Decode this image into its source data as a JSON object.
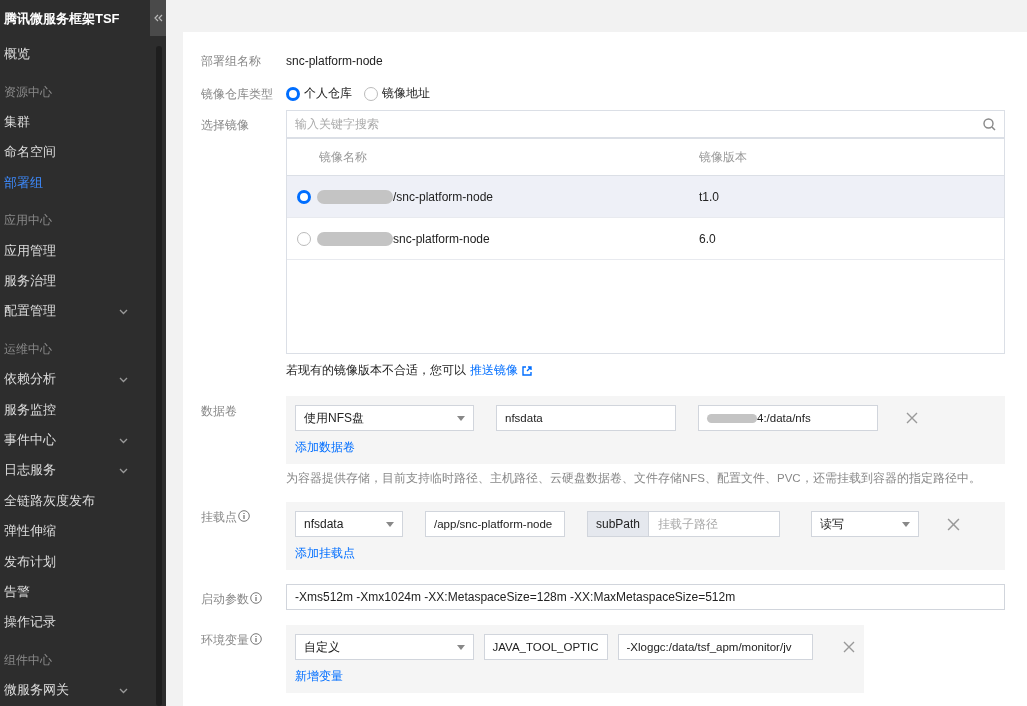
{
  "sidebar": {
    "title": "腾讯微服务框架TSF",
    "items": [
      {
        "kind": "item",
        "label": "概览",
        "selected": false,
        "expandable": false
      },
      {
        "kind": "group",
        "label": "资源中心"
      },
      {
        "kind": "item",
        "label": "集群",
        "selected": false,
        "expandable": false
      },
      {
        "kind": "item",
        "label": "命名空间",
        "selected": false,
        "expandable": false
      },
      {
        "kind": "item",
        "label": "部署组",
        "selected": true,
        "expandable": false
      },
      {
        "kind": "group",
        "label": "应用中心"
      },
      {
        "kind": "item",
        "label": "应用管理",
        "selected": false,
        "expandable": false
      },
      {
        "kind": "item",
        "label": "服务治理",
        "selected": false,
        "expandable": false
      },
      {
        "kind": "item",
        "label": "配置管理",
        "selected": false,
        "expandable": true
      },
      {
        "kind": "group",
        "label": "运维中心"
      },
      {
        "kind": "item",
        "label": "依赖分析",
        "selected": false,
        "expandable": true
      },
      {
        "kind": "item",
        "label": "服务监控",
        "selected": false,
        "expandable": false
      },
      {
        "kind": "item",
        "label": "事件中心",
        "selected": false,
        "expandable": true
      },
      {
        "kind": "item",
        "label": "日志服务",
        "selected": false,
        "expandable": true
      },
      {
        "kind": "item",
        "label": "全链路灰度发布",
        "selected": false,
        "expandable": false
      },
      {
        "kind": "item",
        "label": "弹性伸缩",
        "selected": false,
        "expandable": false
      },
      {
        "kind": "item",
        "label": "发布计划",
        "selected": false,
        "expandable": false
      },
      {
        "kind": "item",
        "label": "告警",
        "selected": false,
        "expandable": false
      },
      {
        "kind": "item",
        "label": "操作记录",
        "selected": false,
        "expandable": false
      },
      {
        "kind": "group",
        "label": "组件中心"
      },
      {
        "kind": "item",
        "label": "微服务网关",
        "selected": false,
        "expandable": true
      }
    ]
  },
  "form": {
    "deploy_group": {
      "label": "部署组名称",
      "value": "snc-platform-node"
    },
    "repo_type": {
      "label": "镜像仓库类型",
      "options": [
        {
          "label": "个人仓库",
          "selected": true
        },
        {
          "label": "镜像地址",
          "selected": false
        }
      ]
    },
    "image": {
      "label": "选择镜像",
      "placeholder": "输入关键字搜索",
      "columns": [
        "镜像名称",
        "镜像版本"
      ],
      "rows": [
        {
          "name": "/snc-platform-node",
          "version": "t1.0",
          "selected": true
        },
        {
          "name": "snc-platform-node",
          "version": "6.0",
          "selected": false
        }
      ]
    },
    "push_note": {
      "text": "若现有的镜像版本不合适，您可以",
      "link": "推送镜像"
    },
    "volumes": {
      "label": "数据卷",
      "rows": [
        {
          "type": "使用NFS盘",
          "name": "nfsdata",
          "source": "4:/data/nfs"
        }
      ],
      "add_link": "添加数据卷",
      "hint": "为容器提供存储，目前支持临时路径、主机路径、云硬盘数据卷、文件存储NFS、配置文件、PVC，还需挂载到容器的指定路径中。"
    },
    "mounts": {
      "label": "挂载点",
      "info": true,
      "rows": [
        {
          "volume": "nfsdata",
          "path": "/app/snc-platform-node",
          "subpath_label": "subPath",
          "subpath_placeholder": "挂载子路径",
          "mode": "读写"
        }
      ],
      "add_link": "添加挂载点"
    },
    "jvm": {
      "label": "启动参数",
      "info": true,
      "value": "-Xms512m -Xmx1024m -XX:MetaspaceSize=128m -XX:MaxMetaspaceSize=512m"
    },
    "env": {
      "label": "环境变量",
      "info": true,
      "rows": [
        {
          "type": "自定义",
          "name": "JAVA_TOOL_OPTIC",
          "value": "-Xloggc:/data/tsf_apm/monitor/jv"
        }
      ],
      "add_link": "新增变量"
    }
  }
}
